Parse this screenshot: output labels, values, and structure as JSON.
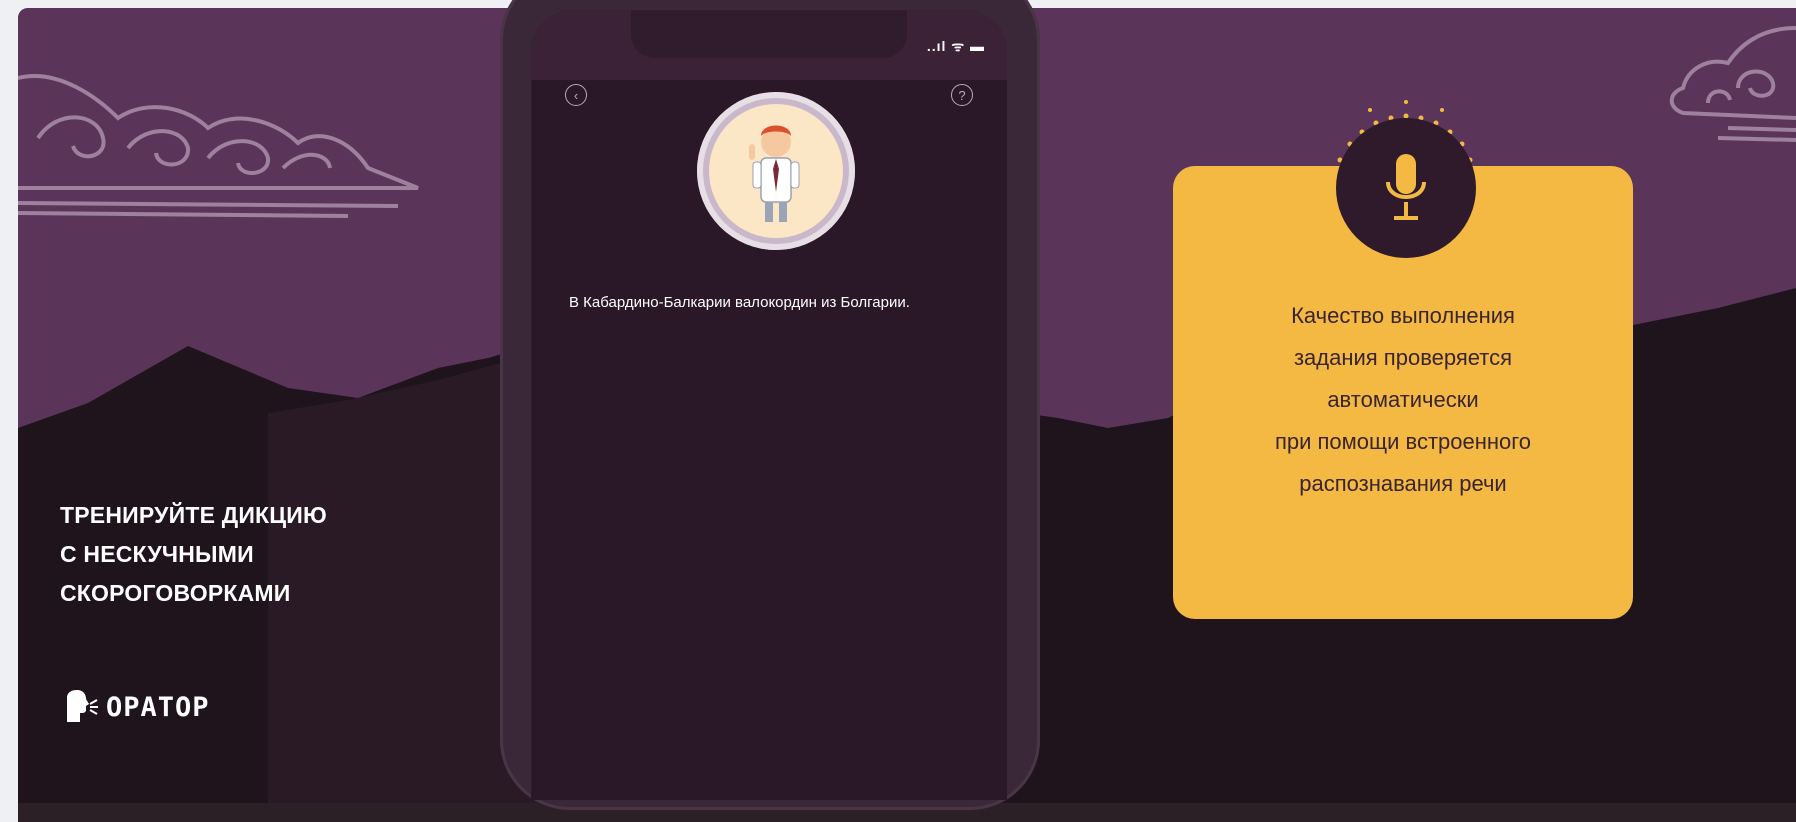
{
  "banner": {
    "tagline_lines": [
      "ТРЕНИРУЙТЕ ДИКЦИЮ",
      "С НЕСКУЧНЫМИ",
      "СКОРОГОВОРКАМИ"
    ],
    "logo_text": "ОРАТОР"
  },
  "phone": {
    "status_icons": "..ıl ᯤ ▬",
    "back_icon": "chevron-left-icon",
    "help_icon": "question-icon",
    "phrase": "В Кабардино-Балкарии валокордин из Болгарии."
  },
  "card": {
    "icon": "microphone-icon",
    "lines": [
      "Качество выполнения",
      "задания проверяется",
      "автоматически",
      "при помощи встроенного",
      "распознавания речи"
    ]
  },
  "colors": {
    "sky": "#5a3559",
    "mountains": "#241620",
    "card": "#f4b942",
    "screen": "#2a1828"
  }
}
